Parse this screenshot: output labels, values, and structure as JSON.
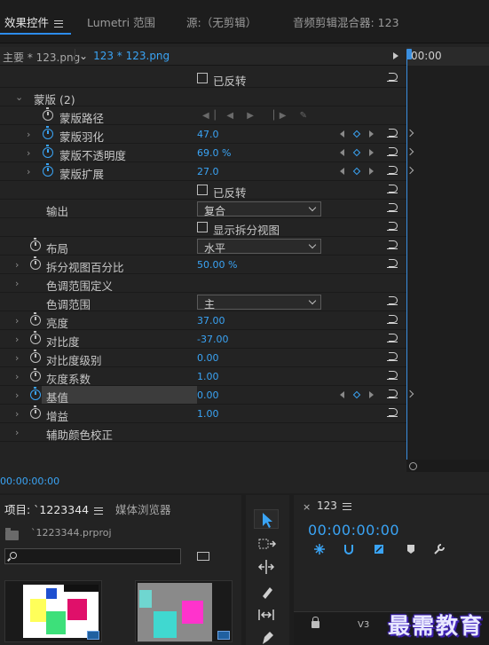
{
  "tabs": {
    "effect_controls": "效果控件",
    "lumetri": "Lumetri 范围",
    "source": "源:（无剪辑）",
    "audio_mixer": "音频剪辑混合器: 123"
  },
  "sequence_bar": {
    "master": "主要 * 123.png",
    "clip": "123 * 123.png",
    "mini_timecode": "00:00"
  },
  "rows": {
    "r0": {
      "checkbox_label": "已反转"
    },
    "r1": {
      "label": "蒙版 (2)"
    },
    "r2": {
      "label": "蒙版路径"
    },
    "r3": {
      "label": "蒙版羽化",
      "value": "47.0"
    },
    "r4": {
      "label": "蒙版不透明度",
      "value": "69.0 %"
    },
    "r5": {
      "label": "蒙版扩展",
      "value": "27.0"
    },
    "r6": {
      "checkbox_label": "已反转"
    },
    "r7": {
      "label": "输出",
      "dropdown": "复合"
    },
    "r8": {
      "checkbox_label": "显示拆分视图"
    },
    "r9": {
      "label": "布局",
      "dropdown": "水平"
    },
    "r10": {
      "label": "拆分视图百分比",
      "value": "50.00 %"
    },
    "r11": {
      "label": "色调范围定义"
    },
    "r12": {
      "label": "色调范围",
      "dropdown": "主"
    },
    "r13": {
      "label": "亮度",
      "value": "37.00"
    },
    "r14": {
      "label": "对比度",
      "value": "-37.00"
    },
    "r15": {
      "label": "对比度级别",
      "value": "0.00"
    },
    "r16": {
      "label": "灰度系数",
      "value": "1.00"
    },
    "r17": {
      "label": "基值",
      "value": "0.00"
    },
    "r18": {
      "label": "增益",
      "value": "1.00"
    },
    "r19": {
      "label": "辅助颜色校正"
    }
  },
  "bottom_timecode": "00:00:00:00",
  "project": {
    "tab": "项目: `1223344",
    "media_browser": "媒体浏览器",
    "file": "`1223344.prproj"
  },
  "program": {
    "tab": "123",
    "timecode": "00:00:00:00",
    "track": "V3"
  },
  "watermark": "最需教育",
  "colors": {
    "accent_blue": "#3aa4f5",
    "panel_bg": "#232323"
  }
}
